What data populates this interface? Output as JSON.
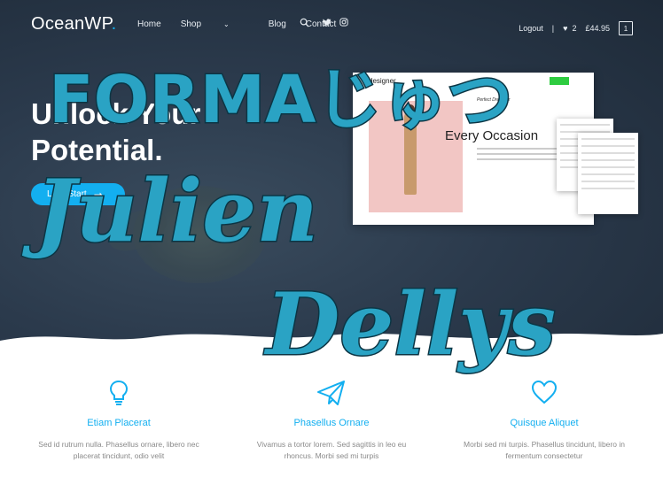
{
  "header": {
    "logo_main": "OceanWP",
    "logo_dot": ".",
    "nav": [
      {
        "label": "Home"
      },
      {
        "label": "Shop"
      },
      {
        "label": "Blog"
      },
      {
        "label": "Contact"
      }
    ],
    "logout_label": "Logout",
    "separator": "|",
    "wishlist_count": "2",
    "cart_total": "£44.95",
    "cart_count": "1"
  },
  "hero": {
    "line1": "Unlock Your",
    "line2": "Potential.",
    "cta_label": "Let's Start",
    "cta_arrow": "➞"
  },
  "mock": {
    "brand": "designer.",
    "small_heading": "Perfect Dress for",
    "big_heading": "Every Occasion"
  },
  "overlay": {
    "word1": "FORMAじゅつ",
    "word2": "Julien",
    "word3": "Dellys",
    "color": "#2aa3c4"
  },
  "features": [
    {
      "icon": "lightbulb-icon",
      "title": "Etiam Placerat",
      "desc_line1": "Sed id rutrum nulla. Phasellus ornare, libero nec",
      "desc_line2": "placerat tincidunt, odio velit"
    },
    {
      "icon": "paper-plane-icon",
      "title": "Phasellus Ornare",
      "desc_line1": "Vivamus a tortor lorem. Sed sagittis in leo eu",
      "desc_line2": "rhoncus. Morbi sed mi turpis"
    },
    {
      "icon": "heart-icon",
      "title": "Quisque Aliquet",
      "desc_line1": "Morbi sed mi turpis. Phasellus tincidunt, libero in",
      "desc_line2": "fermentum consectetur"
    }
  ],
  "colors": {
    "accent": "#13aff0",
    "hero_bg": "#2b3a4c"
  }
}
